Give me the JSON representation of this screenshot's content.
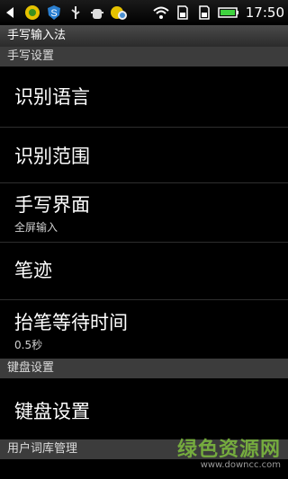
{
  "status_bar": {
    "time": "17:50",
    "icons": [
      "back-arrow-icon",
      "app-icon-1",
      "app-icon-2",
      "usb-icon",
      "debug-icon",
      "app-icon-3",
      "wifi-icon",
      "sd-card-icon",
      "sd-card-icon-2",
      "battery-icon"
    ],
    "battery_color": "#3fd23f"
  },
  "title_bar": {
    "title": "手写输入法"
  },
  "sections": {
    "handwriting": "手写设置",
    "keyboard": "键盘设置",
    "user_dict": "用户词库管理"
  },
  "items": [
    {
      "label": "识别语言",
      "sub": ""
    },
    {
      "label": "识别范围",
      "sub": ""
    },
    {
      "label": "手写界面",
      "sub": "全屏输入"
    },
    {
      "label": "笔迹",
      "sub": ""
    },
    {
      "label": "抬笔等待时间",
      "sub": "0.5秒"
    },
    {
      "label": "键盘设置",
      "sub": ""
    }
  ],
  "watermark": {
    "text": "绿色资源网",
    "url": "www.downcc.com"
  }
}
